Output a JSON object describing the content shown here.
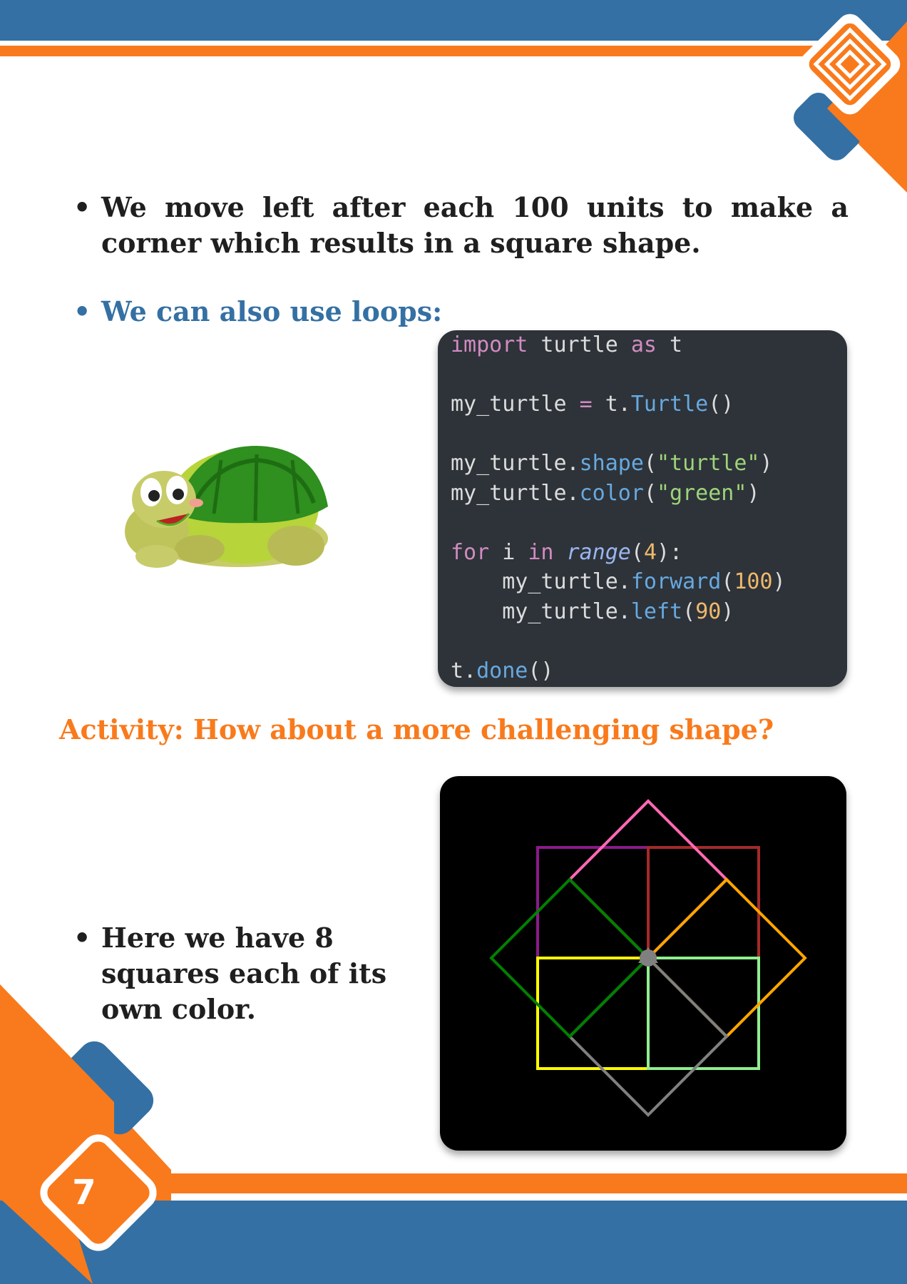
{
  "page_number": "7",
  "bullets": {
    "square_explanation": "We move left after each 100 units to make a corner which results in a square shape.",
    "loops_intro": "We can also use loops:",
    "eight_squares": "Here we have 8 squares each of its own color."
  },
  "activity_heading": "Activity: How about a more challenging shape?",
  "code": {
    "line1": [
      "import",
      " turtle ",
      "as",
      " t"
    ],
    "line2": [
      "my_turtle ",
      "=",
      " t.",
      "Turtle",
      "()"
    ],
    "line3": [
      "my_turtle.",
      "shape",
      "(",
      "\"turtle\"",
      ")"
    ],
    "line4": [
      "my_turtle.",
      "color",
      "(",
      "\"green\"",
      ")"
    ],
    "line5": [
      "for",
      " i ",
      "in",
      " ",
      "range",
      "(",
      "4",
      "):"
    ],
    "line6": [
      "    my_turtle.",
      "forward",
      "(",
      "100",
      ")"
    ],
    "line7": [
      "    my_turtle.",
      "left",
      "(",
      "90",
      ")"
    ],
    "line8": [
      "t.",
      "done",
      "()"
    ]
  },
  "colors": {
    "brand_blue": "#3470a3",
    "brand_orange": "#f97a1c",
    "square_colors": [
      "#8b1a8b",
      "#ff69b4",
      "#a52a2a",
      "#ffa500",
      "#90ee90",
      "#808080",
      "#ffff00",
      "#008000"
    ]
  },
  "icons": [
    "turtle-illustration",
    "maze-diamond-icon"
  ]
}
